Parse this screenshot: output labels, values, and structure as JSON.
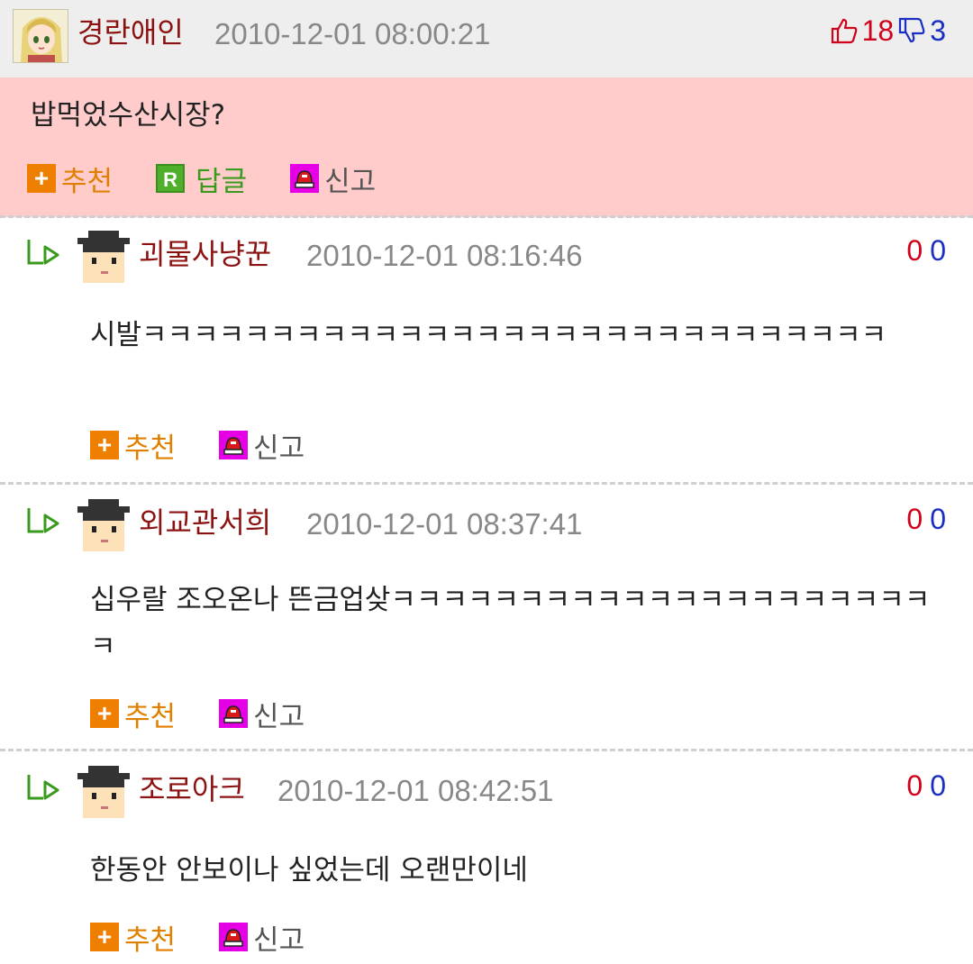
{
  "colors": {
    "accent_red": "#8c1111",
    "up": "#d0021b",
    "down": "#1a2fc2",
    "recommend": "#ee7f00",
    "reply": "#4fae2a",
    "report": "#e500e5",
    "main_bg": "#ffcccb"
  },
  "main": {
    "avatar_icon": "anime-girl-avatar-icon",
    "author": "경란애인",
    "time": "2010-12-01 08:00:21",
    "upvotes": "18",
    "downvotes": "3",
    "text": "밥먹었수산시장?",
    "actions": {
      "recommend": "추천",
      "reply": "답글",
      "report": "신고"
    }
  },
  "replies": [
    {
      "author": "괴물사냥꾼",
      "time": "2010-12-01 08:16:46",
      "up": "0",
      "down": "0",
      "text": "시발ㅋㅋㅋㅋㅋㅋㅋㅋㅋㅋㅋㅋㅋㅋㅋㅋㅋㅋㅋㅋㅋㅋㅋㅋㅋㅋㅋㅋㅋ",
      "actions": {
        "recommend": "추천",
        "report": "신고"
      }
    },
    {
      "author": "외교관서희",
      "time": "2010-12-01 08:37:41",
      "up": "0",
      "down": "0",
      "text": "십우랄 조오온나 뜬금업샂ㅋㅋㅋㅋㅋㅋㅋㅋㅋㅋㅋㅋㅋㅋㅋㅋㅋㅋㅋㅋㅋㅋ",
      "actions": {
        "recommend": "추천",
        "report": "신고"
      }
    },
    {
      "author": "조로아크",
      "time": "2010-12-01 08:42:51",
      "up": "0",
      "down": "0",
      "text": "한동안 안보이나 싶었는데 오랜만이네",
      "actions": {
        "recommend": "추천",
        "report": "신고"
      }
    }
  ]
}
